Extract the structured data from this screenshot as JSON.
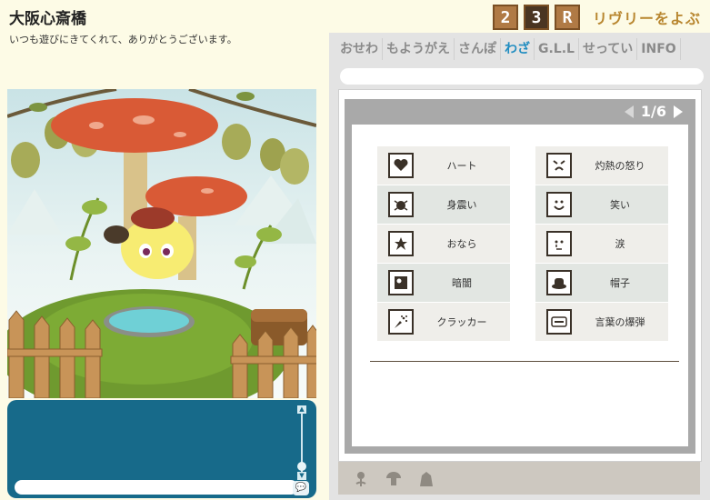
{
  "header": {
    "title": "大阪心斎橋",
    "subtitle": "いつも遊びにきてくれて、ありがとうございます。",
    "counters": [
      "2",
      "3",
      "R"
    ],
    "call_label": "リヴリーをよぶ"
  },
  "tabs": [
    {
      "label": "おせわ",
      "active": false
    },
    {
      "label": "もようがえ",
      "active": false
    },
    {
      "label": "さんぽ",
      "active": false
    },
    {
      "label": "わざ",
      "active": true
    },
    {
      "label": "G.L.L",
      "active": false
    },
    {
      "label": "せってい",
      "active": false
    },
    {
      "label": "INFO",
      "active": false
    }
  ],
  "pager": {
    "text": "1/6"
  },
  "skills": [
    {
      "label": "ハート",
      "icon": "heart-icon"
    },
    {
      "label": "灼熱の怒り",
      "icon": "anger-face-icon"
    },
    {
      "label": "身震い",
      "icon": "shiver-icon"
    },
    {
      "label": "笑い",
      "icon": "laugh-face-icon"
    },
    {
      "label": "おなら",
      "icon": "fart-icon"
    },
    {
      "label": "涙",
      "icon": "tear-face-icon"
    },
    {
      "label": "暗闇",
      "icon": "darkness-icon"
    },
    {
      "label": "帽子",
      "icon": "hat-icon"
    },
    {
      "label": "クラッカー",
      "icon": "cracker-icon"
    },
    {
      "label": "言葉の爆弾",
      "icon": "word-bomb-icon"
    }
  ],
  "chat": {
    "input_value": "",
    "send_icon": "speech-bubble-icon"
  },
  "toolbar": {
    "icons": [
      "flower-icon",
      "mushroom-icon",
      "pet-icon"
    ]
  }
}
